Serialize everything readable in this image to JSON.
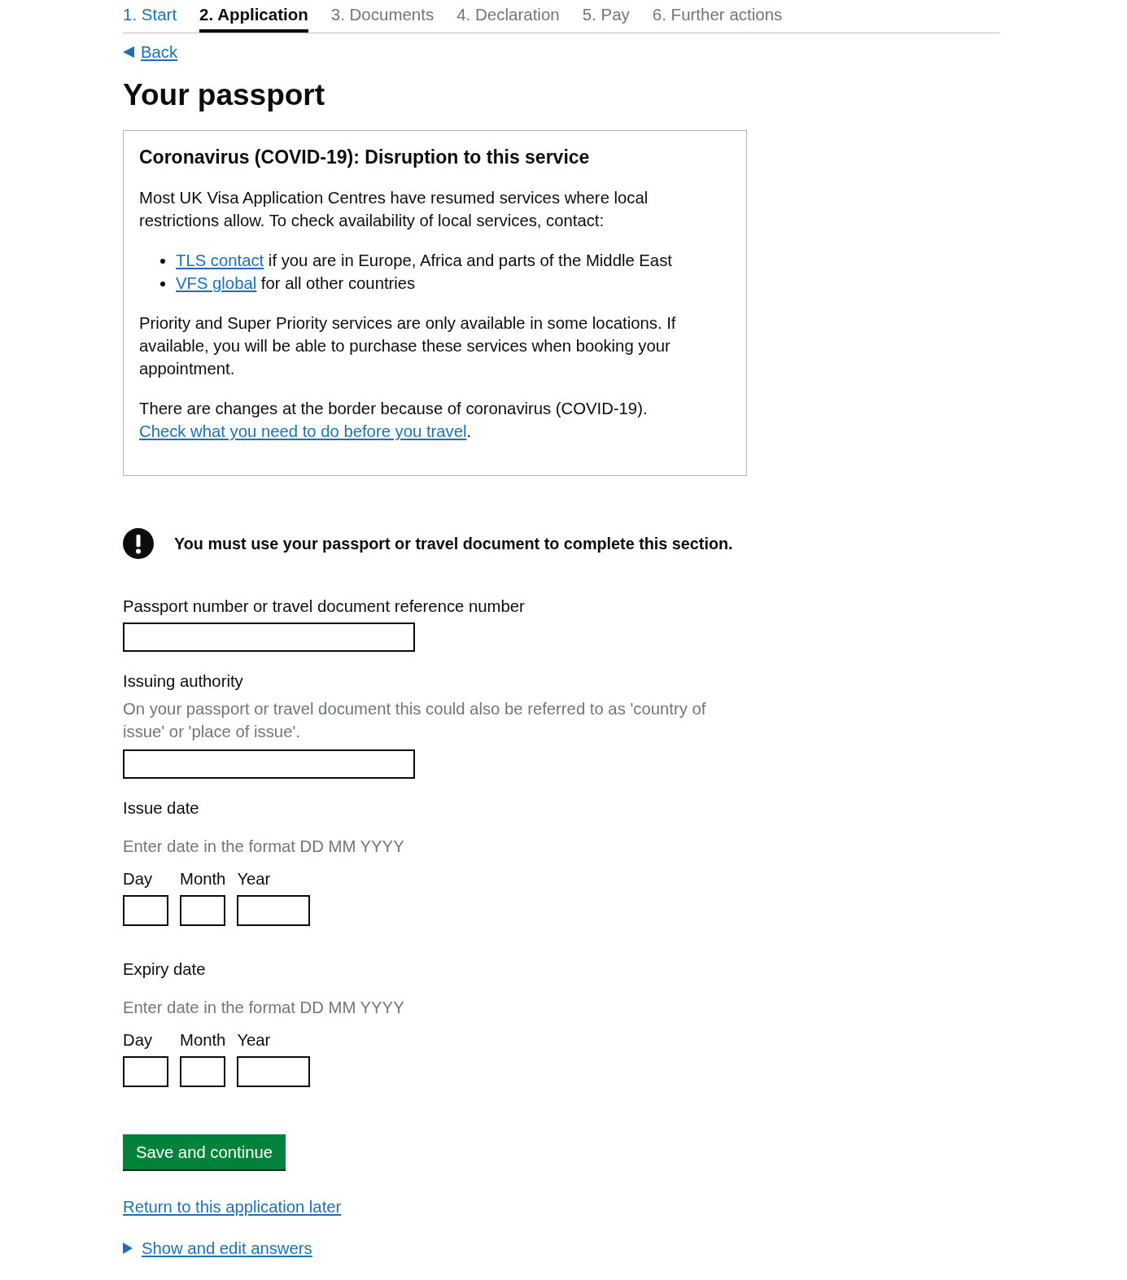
{
  "steps": [
    {
      "label": "1. Start",
      "selected": false,
      "completed": true
    },
    {
      "label": "2. Application",
      "selected": true,
      "completed": false
    },
    {
      "label": "3. Documents",
      "selected": false,
      "completed": false
    },
    {
      "label": "4. Declaration",
      "selected": false,
      "completed": false
    },
    {
      "label": "5. Pay",
      "selected": false,
      "completed": false
    },
    {
      "label": "6. Further actions",
      "selected": false,
      "completed": false
    }
  ],
  "back_link": "Back",
  "title": "Your passport",
  "notice": {
    "heading": "Coronavirus (COVID-19): Disruption to this service",
    "blocks": [
      {
        "kind": "paragraph",
        "parts": [
          {
            "kind": "text",
            "text": "Most UK Visa Application Centres have resumed services where local restrictions allow. To check availability of local services, contact:"
          }
        ]
      },
      {
        "kind": "list",
        "items": [
          {
            "parts": [
              {
                "kind": "link",
                "text": "TLS contact"
              },
              {
                "kind": "text",
                "text": " if you are in Europe, Africa and parts of the Middle East"
              }
            ]
          },
          {
            "parts": [
              {
                "kind": "link",
                "text": "VFS global"
              },
              {
                "kind": "text",
                "text": " for all other countries"
              }
            ]
          }
        ]
      },
      {
        "kind": "paragraph",
        "parts": [
          {
            "kind": "text",
            "text": "Priority and Super Priority services are only available in some locations. If available, you will be able to purchase these services when booking your appointment."
          }
        ]
      },
      {
        "kind": "paragraph",
        "parts": [
          {
            "kind": "text",
            "text": "There are changes at the border because of coronavirus (COVID-19). "
          },
          {
            "kind": "link",
            "text": "Check what you need to do before you travel"
          },
          {
            "kind": "text",
            "text": "."
          }
        ]
      }
    ]
  },
  "warning": {
    "text": "You must use your passport or travel document to complete this section."
  },
  "fields": [
    {
      "kind": "text",
      "label": "Passport number or travel document reference number"
    },
    {
      "kind": "text",
      "label": "Issuing authority",
      "hint": "On your passport or travel document this could also be referred to as 'country of issue' or 'place of issue'."
    },
    {
      "kind": "date",
      "label": "Issue date",
      "hint": "Enter date in the format DD MM YYYY",
      "parts": [
        {
          "kind": "day",
          "label": "Day"
        },
        {
          "kind": "month",
          "label": "Month"
        },
        {
          "kind": "year",
          "label": "Year"
        }
      ]
    },
    {
      "kind": "date",
      "label": "Expiry date",
      "hint": "Enter date in the format DD MM YYYY",
      "parts": [
        {
          "kind": "day",
          "label": "Day"
        },
        {
          "kind": "month",
          "label": "Month"
        },
        {
          "kind": "year",
          "label": "Year"
        }
      ]
    }
  ],
  "primary_button": "Save and continue",
  "save_link": "Return to this application later",
  "details": {
    "summary": "Show and edit answers",
    "expanded": false
  }
}
